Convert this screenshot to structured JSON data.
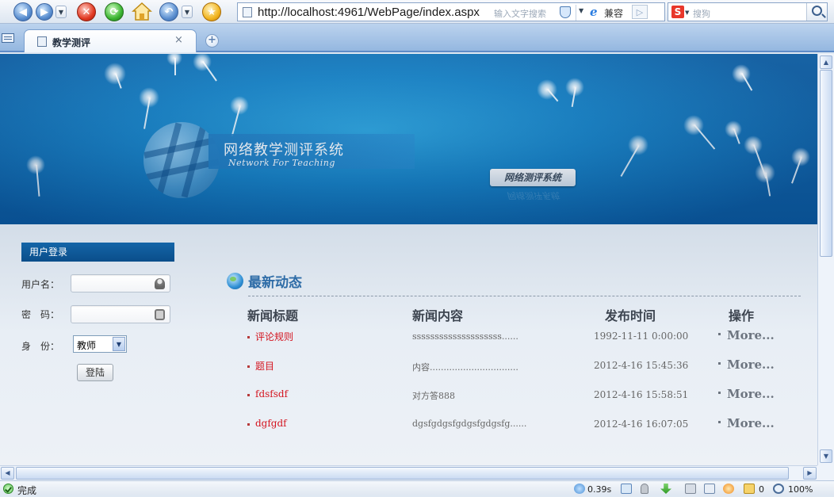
{
  "browser": {
    "address_url": "http://localhost:4961/WebPage/index.aspx",
    "address_hint": "输入文字搜索",
    "compat_label": "兼容",
    "search_placeholder": "搜狗",
    "search_engine_icon": "S"
  },
  "tab": {
    "title": "教学测评",
    "close": "×",
    "new": "+"
  },
  "banner": {
    "system_title_cn": "网络教学测评系统",
    "system_title_en": "Network For Teaching",
    "badge": "网络测评系统",
    "badge_reflection": "网络测评系统"
  },
  "login": {
    "header": "用户登录",
    "username_label": "用户名：",
    "password_label": "密　码：",
    "role_label": "身　份：",
    "role_value": "教师",
    "submit": "登陆"
  },
  "news": {
    "title": "最新动态",
    "columns": [
      "新闻标题",
      "新闻内容",
      "发布时间",
      "操作"
    ],
    "rows": [
      {
        "title": "评论规则",
        "content": "ssssssssssssssssssss......",
        "date": "1992-11-11 0:00:00",
        "action": "More..."
      },
      {
        "title": "题目",
        "content": "内容................................",
        "date": "2012-4-16 15:45:36",
        "action": "More..."
      },
      {
        "title": "fdsfsdf",
        "content": "对方答888",
        "date": "2012-4-16 15:58:51",
        "action": "More..."
      },
      {
        "title": "dgfgdf",
        "content": "dgsfgdgsfgdgsfgdgsfg......",
        "date": "2012-4-16 16:07:05",
        "action": "More..."
      }
    ]
  },
  "status": {
    "text": "完成",
    "load_time": "0.39s",
    "count": "0",
    "zoom": "100%"
  },
  "colors": {
    "banner": "#1581c5",
    "login_header": "#0a4e8a",
    "news_title": "#2e6ca7",
    "news_link": "#d4141f"
  }
}
